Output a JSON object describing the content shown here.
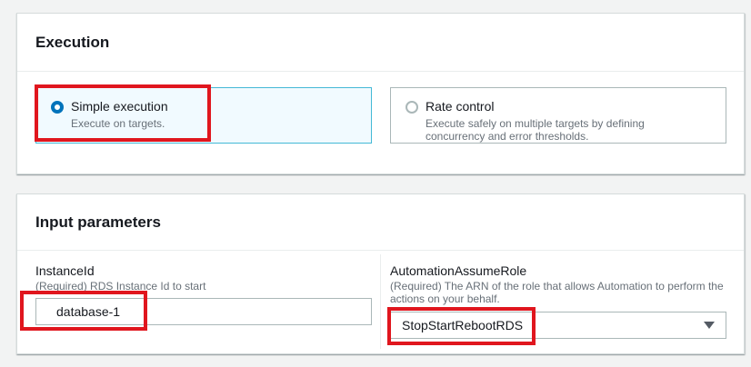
{
  "execution": {
    "title": "Execution",
    "options": [
      {
        "label": "Simple execution",
        "description": "Execute on targets.",
        "selected": true
      },
      {
        "label": "Rate control",
        "description": "Execute safely on multiple targets by defining concurrency and error thresholds.",
        "selected": false
      }
    ]
  },
  "input_parameters": {
    "title": "Input parameters",
    "instance_id": {
      "label": "InstanceId",
      "description": "(Required) RDS Instance Id to start",
      "value": "database-1"
    },
    "automation_assume_role": {
      "label": "AutomationAssumeRole",
      "description": "(Required) The ARN of the role that allows Automation to perform the actions on your behalf.",
      "selected_value": "StopStartRebootRDS"
    }
  },
  "colors": {
    "selected_radio": "#0073bb",
    "selected_tile_border": "#44b9d6",
    "selected_tile_background": "#f1faff",
    "highlight": "#e0161e"
  },
  "icons": {
    "select_caret": "caret-down-icon"
  }
}
